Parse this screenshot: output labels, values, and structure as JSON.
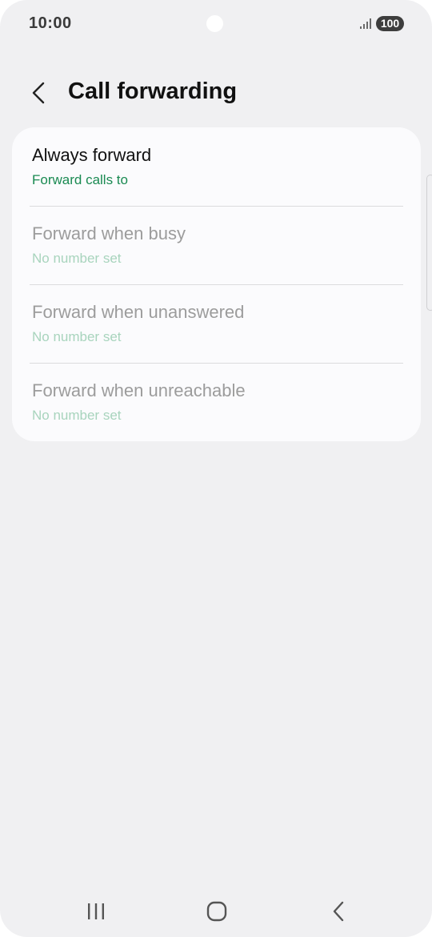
{
  "status_bar": {
    "time": "10:00",
    "battery": "100",
    "icons": [
      "signal-icon",
      "battery-icon"
    ]
  },
  "header": {
    "back_icon": "back-arrow-icon",
    "title": "Call forwarding"
  },
  "options": [
    {
      "title": "Always forward",
      "subtitle": "Forward calls to",
      "enabled": true
    },
    {
      "title": "Forward when busy",
      "subtitle": "No number set",
      "enabled": false
    },
    {
      "title": "Forward when unanswered",
      "subtitle": "No number set",
      "enabled": false
    },
    {
      "title": "Forward when unreachable",
      "subtitle": "No number set",
      "enabled": false
    }
  ],
  "nav_bar": {
    "icons": [
      "recent-apps-icon",
      "home-icon",
      "back-icon"
    ]
  },
  "colors": {
    "background": "#f0f0f2",
    "card": "#fbfbfd",
    "accent_green": "#1a8a52",
    "disabled_green": "#a8d4bd",
    "disabled_text": "#9c9c9c"
  }
}
